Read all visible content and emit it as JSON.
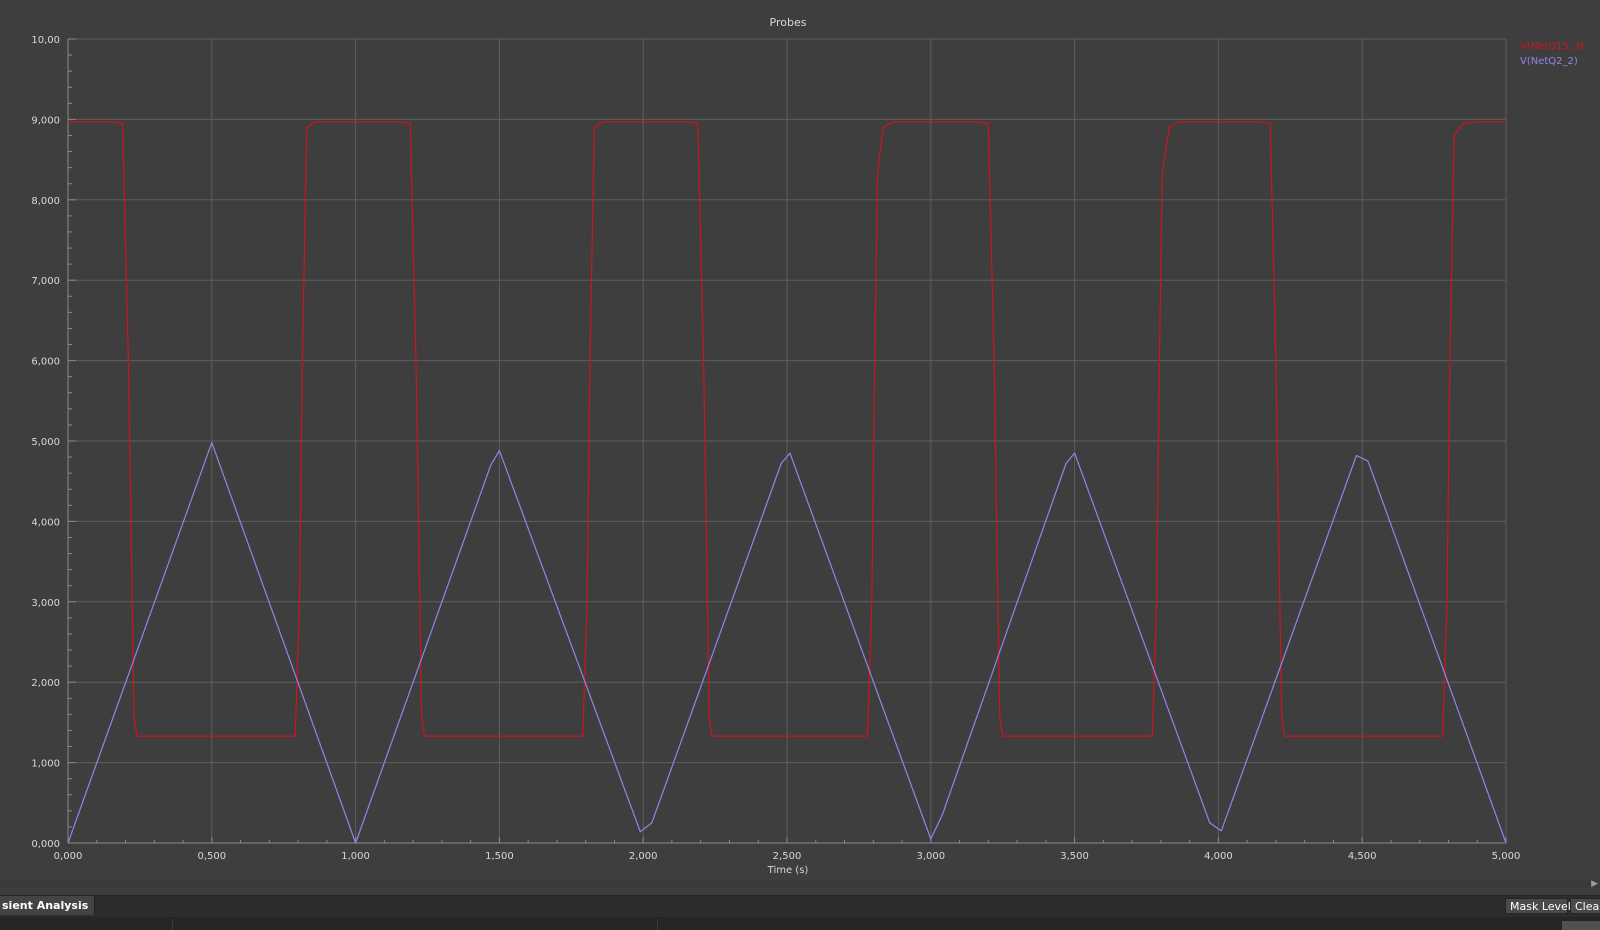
{
  "chart_data": {
    "type": "line",
    "title": "Probes",
    "xlabel": "Time (s)",
    "ylabel": "",
    "xlim": [
      0,
      5
    ],
    "ylim": [
      0,
      10
    ],
    "x_ticks": [
      "0,000",
      "0,500",
      "1,000",
      "1,500",
      "2,000",
      "2,500",
      "3,000",
      "3,500",
      "4,000",
      "4,500",
      "5,000"
    ],
    "y_ticks": [
      "0,000",
      "1,000",
      "2,000",
      "3,000",
      "4,000",
      "5,000",
      "6,000",
      "7,000",
      "8,000",
      "9,000",
      "10,00"
    ],
    "grid": true,
    "legend_position": "top-right",
    "series": [
      {
        "name": "V(NetQ15_3)",
        "color": "#d0131e",
        "points": [
          [
            0.0,
            8.97
          ],
          [
            0.15,
            8.97
          ],
          [
            0.19,
            8.95
          ],
          [
            0.21,
            6.0
          ],
          [
            0.23,
            1.55
          ],
          [
            0.24,
            1.33
          ],
          [
            0.79,
            1.33
          ],
          [
            0.805,
            3.0
          ],
          [
            0.815,
            6.0
          ],
          [
            0.83,
            8.9
          ],
          [
            0.86,
            8.97
          ],
          [
            1.15,
            8.97
          ],
          [
            1.19,
            8.95
          ],
          [
            1.21,
            6.0
          ],
          [
            1.23,
            1.55
          ],
          [
            1.24,
            1.33
          ],
          [
            1.79,
            1.33
          ],
          [
            1.805,
            3.0
          ],
          [
            1.815,
            6.0
          ],
          [
            1.83,
            8.9
          ],
          [
            1.86,
            8.97
          ],
          [
            2.15,
            8.97
          ],
          [
            2.19,
            8.95
          ],
          [
            2.21,
            6.0
          ],
          [
            2.23,
            1.55
          ],
          [
            2.24,
            1.33
          ],
          [
            2.78,
            1.33
          ],
          [
            2.795,
            3.0
          ],
          [
            2.805,
            6.0
          ],
          [
            2.815,
            8.35
          ],
          [
            2.835,
            8.9
          ],
          [
            2.87,
            8.97
          ],
          [
            3.15,
            8.97
          ],
          [
            3.2,
            8.95
          ],
          [
            3.22,
            6.0
          ],
          [
            3.24,
            1.55
          ],
          [
            3.25,
            1.33
          ],
          [
            3.77,
            1.33
          ],
          [
            3.785,
            3.0
          ],
          [
            3.795,
            6.0
          ],
          [
            3.805,
            8.35
          ],
          [
            3.83,
            8.9
          ],
          [
            3.86,
            8.97
          ],
          [
            4.14,
            8.97
          ],
          [
            4.18,
            8.95
          ],
          [
            4.2,
            6.0
          ],
          [
            4.22,
            1.55
          ],
          [
            4.23,
            1.33
          ],
          [
            4.78,
            1.33
          ],
          [
            4.795,
            3.0
          ],
          [
            4.805,
            6.0
          ],
          [
            4.82,
            8.8
          ],
          [
            4.85,
            8.95
          ],
          [
            4.9,
            8.97
          ],
          [
            5.0,
            8.97
          ]
        ]
      },
      {
        "name": "V(NetQ2_2)",
        "color": "#8f86e6",
        "points": [
          [
            0.0,
            0.0
          ],
          [
            0.5,
            4.98
          ],
          [
            1.0,
            0.0
          ],
          [
            1.47,
            4.7
          ],
          [
            1.5,
            4.88
          ],
          [
            1.99,
            0.14
          ],
          [
            2.03,
            0.25
          ],
          [
            2.48,
            4.72
          ],
          [
            2.51,
            4.85
          ],
          [
            3.0,
            0.05
          ],
          [
            3.04,
            0.35
          ],
          [
            3.47,
            4.72
          ],
          [
            3.5,
            4.85
          ],
          [
            3.97,
            0.25
          ],
          [
            4.01,
            0.15
          ],
          [
            4.48,
            4.82
          ],
          [
            4.52,
            4.75
          ],
          [
            5.0,
            0.0
          ]
        ]
      }
    ]
  },
  "bottom_bar": {
    "tab_label": "sient Analysis",
    "mask_level_label": "Mask Level",
    "clear_label": "Clear"
  },
  "scroll": {
    "arrow_glyph": "▶"
  }
}
